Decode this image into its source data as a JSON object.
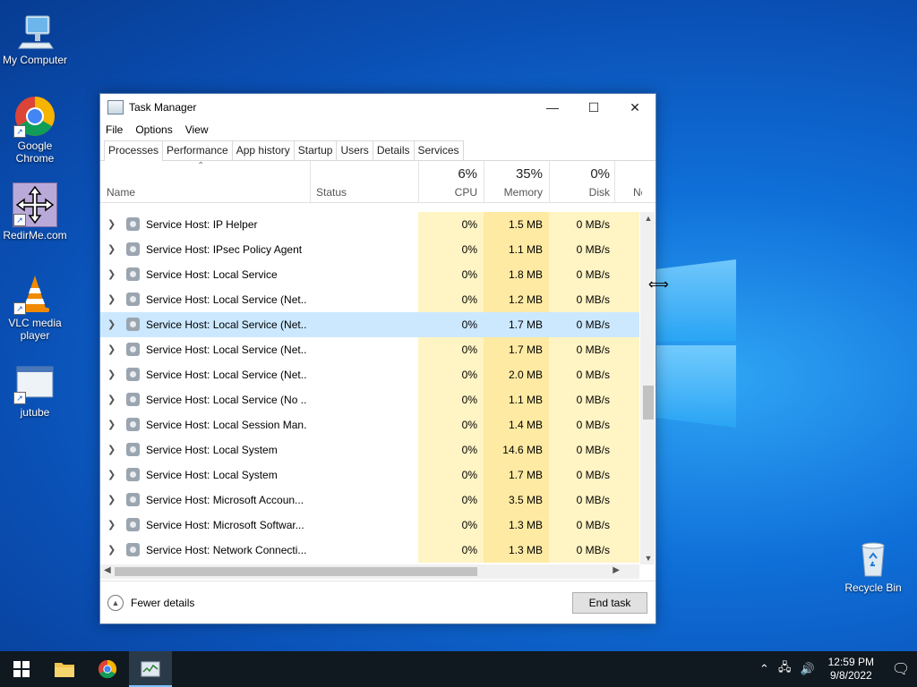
{
  "desktop": {
    "icons": [
      {
        "label": "My Computer",
        "icon": "computer-icon"
      },
      {
        "label": "Google Chrome",
        "icon": "chrome-icon"
      },
      {
        "label": "RedirMe.com",
        "icon": "move-arrows-icon"
      },
      {
        "label": "VLC media player",
        "icon": "vlc-cone-icon"
      },
      {
        "label": "jutube",
        "icon": "window-icon"
      },
      {
        "label": "Recycle Bin",
        "icon": "recycle-bin-icon"
      }
    ]
  },
  "window": {
    "title": "Task Manager",
    "controls": {
      "minimize": "—",
      "maximize": "☐",
      "close": "✕"
    },
    "menu": [
      "File",
      "Options",
      "View"
    ],
    "tabs": [
      "Processes",
      "Performance",
      "App history",
      "Startup",
      "Users",
      "Details",
      "Services"
    ],
    "active_tab": "Processes",
    "columns": {
      "name": "Name",
      "status": "Status",
      "cpu": {
        "pct": "6%",
        "label": "CPU"
      },
      "memory": {
        "pct": "35%",
        "label": "Memory"
      },
      "disk": {
        "pct": "0%",
        "label": "Disk"
      },
      "network": {
        "label": "Netw"
      }
    },
    "processes": [
      {
        "name": "Service Host: IP Helper",
        "cpu": "0%",
        "memory": "1.5 MB",
        "disk": "0 MB/s"
      },
      {
        "name": "Service Host: IPsec Policy Agent",
        "cpu": "0%",
        "memory": "1.1 MB",
        "disk": "0 MB/s"
      },
      {
        "name": "Service Host: Local Service",
        "cpu": "0%",
        "memory": "1.8 MB",
        "disk": "0 MB/s"
      },
      {
        "name": "Service Host: Local Service (Net...",
        "cpu": "0%",
        "memory": "1.2 MB",
        "disk": "0 MB/s"
      },
      {
        "name": "Service Host: Local Service (Net...",
        "cpu": "0%",
        "memory": "1.7 MB",
        "disk": "0 MB/s",
        "selected": true
      },
      {
        "name": "Service Host: Local Service (Net...",
        "cpu": "0%",
        "memory": "1.7 MB",
        "disk": "0 MB/s"
      },
      {
        "name": "Service Host: Local Service (Net...",
        "cpu": "0%",
        "memory": "2.0 MB",
        "disk": "0 MB/s"
      },
      {
        "name": "Service Host: Local Service (No ...",
        "cpu": "0%",
        "memory": "1.1 MB",
        "disk": "0 MB/s"
      },
      {
        "name": "Service Host: Local Session Man...",
        "cpu": "0%",
        "memory": "1.4 MB",
        "disk": "0 MB/s"
      },
      {
        "name": "Service Host: Local System",
        "cpu": "0%",
        "memory": "14.6 MB",
        "disk": "0 MB/s"
      },
      {
        "name": "Service Host: Local System",
        "cpu": "0%",
        "memory": "1.7 MB",
        "disk": "0 MB/s"
      },
      {
        "name": "Service Host: Microsoft Accoun...",
        "cpu": "0%",
        "memory": "3.5 MB",
        "disk": "0 MB/s"
      },
      {
        "name": "Service Host: Microsoft Softwar...",
        "cpu": "0%",
        "memory": "1.3 MB",
        "disk": "0 MB/s"
      },
      {
        "name": "Service Host: Network Connecti...",
        "cpu": "0%",
        "memory": "1.3 MB",
        "disk": "0 MB/s"
      }
    ],
    "footer": {
      "fewer_details": "Fewer details",
      "end_task": "End task"
    }
  },
  "taskbar": {
    "apps": [
      "start-icon",
      "file-explorer-icon",
      "chrome-icon",
      "task-manager-icon"
    ],
    "tray": {
      "time": "12:59 PM",
      "date": "9/8/2022"
    }
  }
}
